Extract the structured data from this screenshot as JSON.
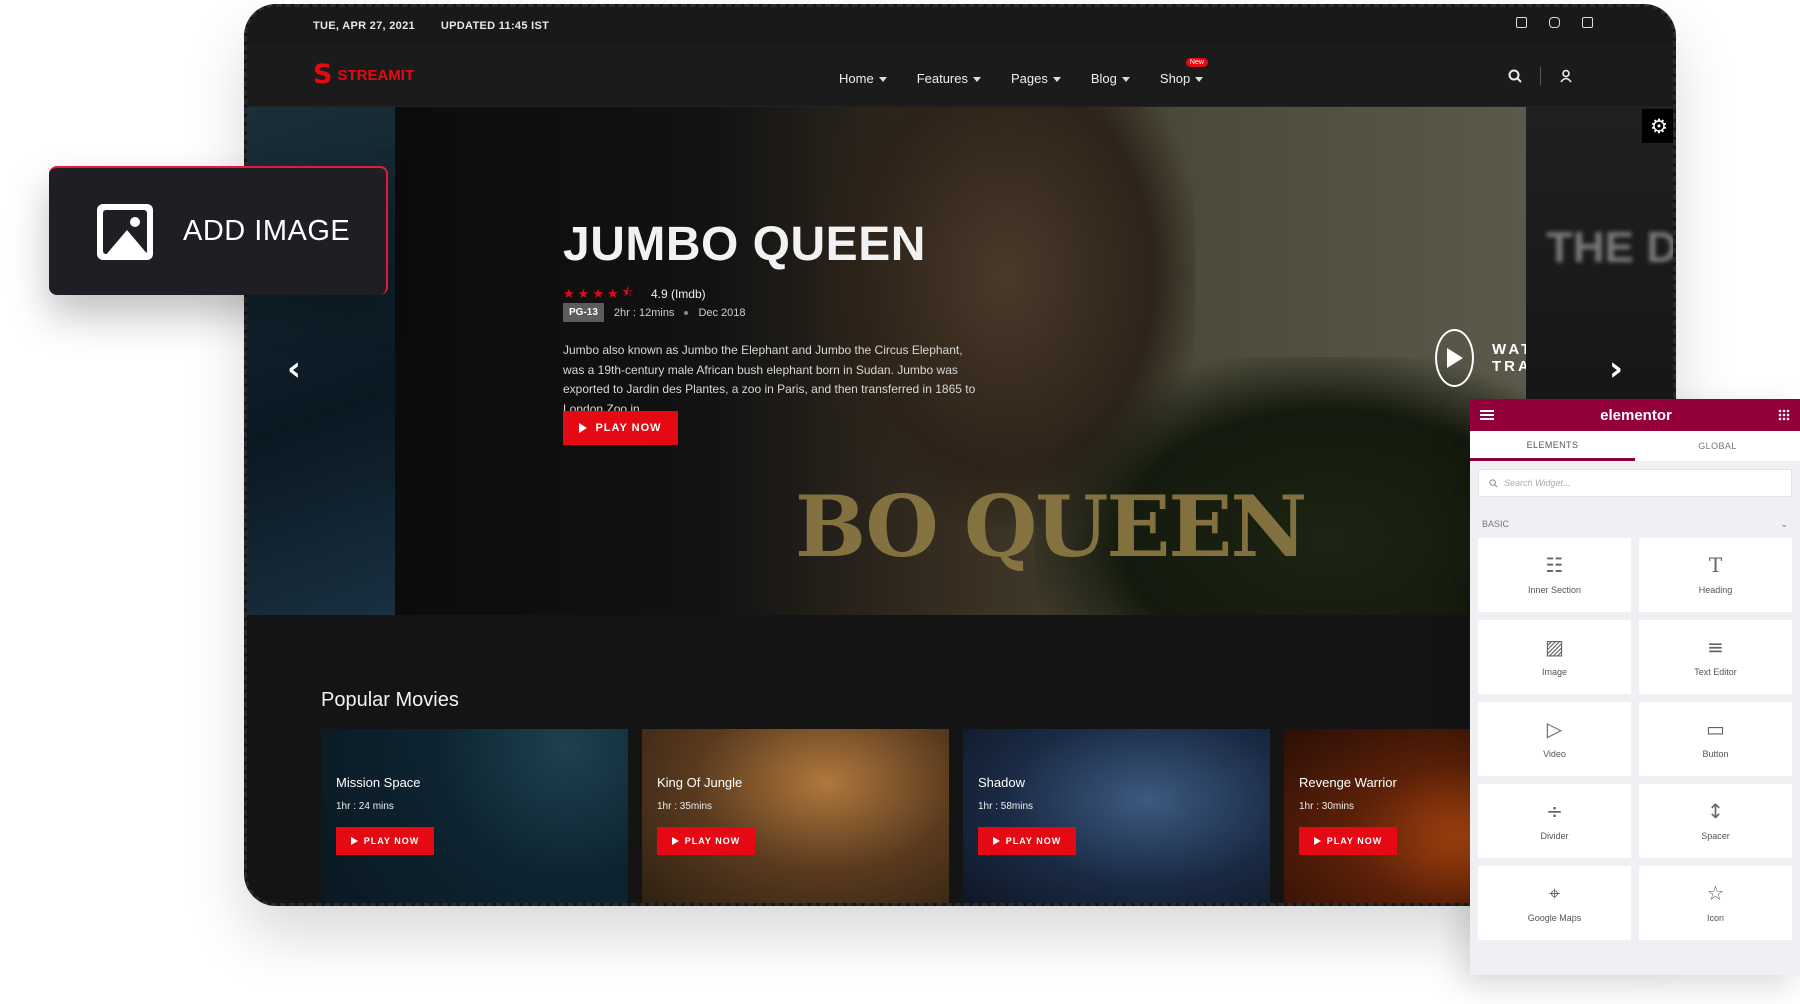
{
  "topbar": {
    "date": "TUE, APR 27, 2021",
    "updated": "UPDATED 11:45 IST"
  },
  "nav": {
    "logo": "STREAMIT",
    "items": [
      {
        "label": "Home"
      },
      {
        "label": "Features"
      },
      {
        "label": "Pages"
      },
      {
        "label": "Blog"
      },
      {
        "label": "Shop",
        "badge": "New"
      }
    ]
  },
  "hero": {
    "title": "JUMBO QUEEN",
    "rating": "4.9 (Imdb)",
    "certificate": "PG-13",
    "duration": "2hr : 12mins",
    "release": "Dec 2018",
    "description": "Jumbo also known as Jumbo the Elephant and Jumbo the Circus Elephant, was a 19th-century male African bush elephant born in Sudan. Jumbo was exported to Jardin des Plantes, a zoo in Paris, and then transferred in 1865 to London Zoo in...",
    "play_label": "PLAY NOW",
    "trailer_label": "WATCH TRAILER",
    "poster_text": "BO QUEEN",
    "next_title": "THE D"
  },
  "popular": {
    "heading": "Popular Movies",
    "movies": [
      {
        "title": "Mission Space",
        "duration": "1hr : 24 mins",
        "play": "PLAY NOW"
      },
      {
        "title": "King Of Jungle",
        "duration": "1hr : 35mins",
        "play": "PLAY NOW"
      },
      {
        "title": "Shadow",
        "duration": "1hr : 58mins",
        "play": "PLAY NOW"
      },
      {
        "title": "Revenge Warrior",
        "duration": "1hr : 30mins",
        "play": "PLAY NOW"
      }
    ]
  },
  "add_image": {
    "label": "ADD IMAGE"
  },
  "elementor": {
    "brand": "elementor",
    "tabs": [
      "ELEMENTS",
      "GLOBAL"
    ],
    "search_placeholder": "Search Widget...",
    "section": "BASIC",
    "widgets": [
      {
        "label": "Inner Section",
        "icon": "inner-section-icon"
      },
      {
        "label": "Heading",
        "icon": "heading-icon"
      },
      {
        "label": "Image",
        "icon": "image-icon"
      },
      {
        "label": "Text Editor",
        "icon": "text-editor-icon"
      },
      {
        "label": "Video",
        "icon": "video-icon"
      },
      {
        "label": "Button",
        "icon": "button-icon"
      },
      {
        "label": "Divider",
        "icon": "divider-icon"
      },
      {
        "label": "Spacer",
        "icon": "spacer-icon"
      },
      {
        "label": "Google Maps",
        "icon": "map-icon"
      },
      {
        "label": "Icon",
        "icon": "star-icon"
      }
    ]
  },
  "colors": {
    "accent": "#e50914",
    "elementor": "#93003c"
  }
}
